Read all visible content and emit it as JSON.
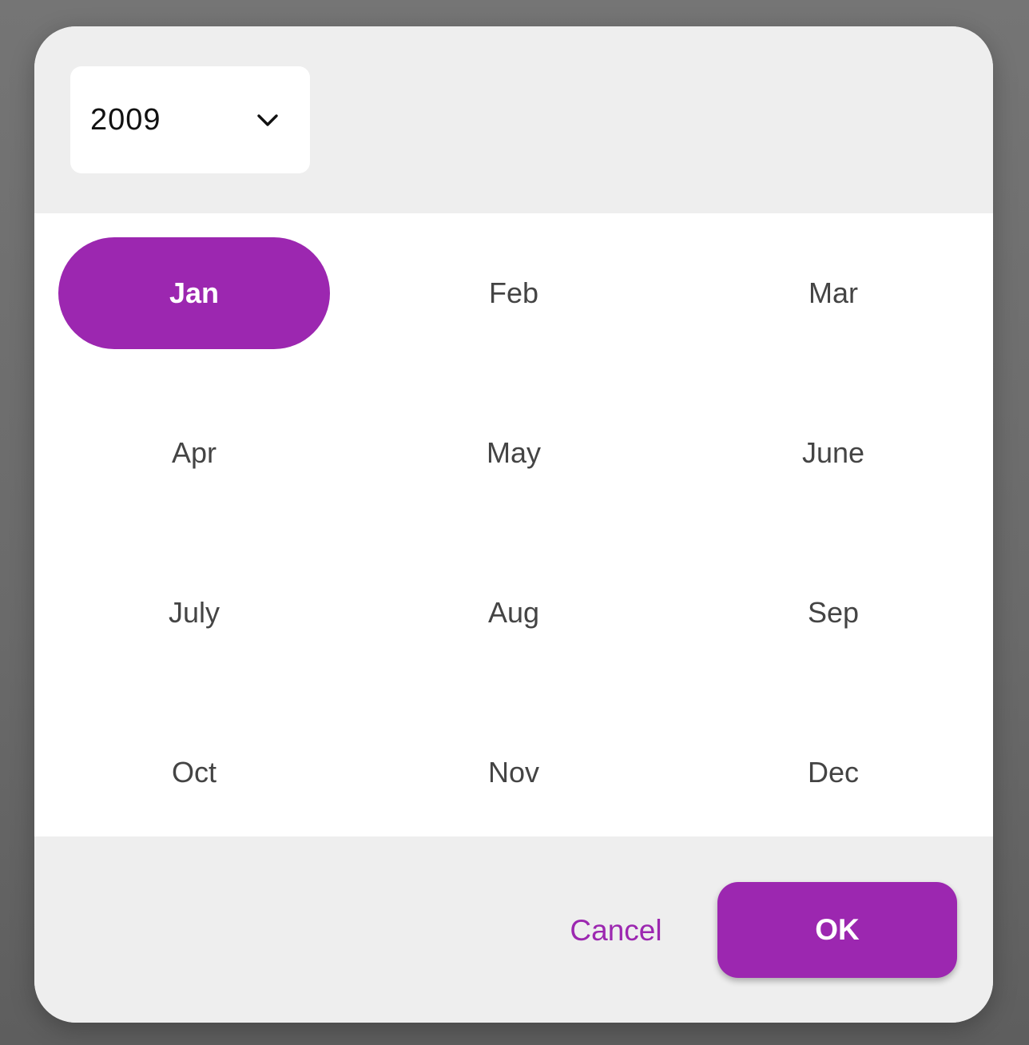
{
  "year_select": {
    "value": "2009",
    "icon": "chevron-down-icon"
  },
  "months": [
    {
      "label": "Jan",
      "selected": true
    },
    {
      "label": "Feb",
      "selected": false
    },
    {
      "label": "Mar",
      "selected": false
    },
    {
      "label": "Apr",
      "selected": false
    },
    {
      "label": "May",
      "selected": false
    },
    {
      "label": "June",
      "selected": false
    },
    {
      "label": "July",
      "selected": false
    },
    {
      "label": "Aug",
      "selected": false
    },
    {
      "label": "Sep",
      "selected": false
    },
    {
      "label": "Oct",
      "selected": false
    },
    {
      "label": "Nov",
      "selected": false
    },
    {
      "label": "Dec",
      "selected": false
    }
  ],
  "actions": {
    "cancel_label": "Cancel",
    "ok_label": "OK"
  },
  "colors": {
    "accent": "#9c27b0",
    "dialog_background": "#eeeeee",
    "grid_background": "#ffffff",
    "month_text": "#444444",
    "backdrop": "#707070"
  }
}
